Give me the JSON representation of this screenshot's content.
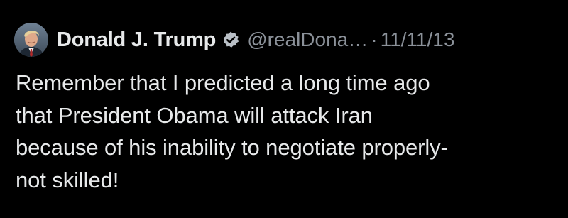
{
  "tweet": {
    "author": {
      "display_name": "Donald J. Trump",
      "handle": "@realDona…",
      "verified": true,
      "avatar_icon": "portrait-avatar"
    },
    "separator": "·",
    "date": "11/11/13",
    "text": "Remember that I predicted a long time ago\nthat President Obama will attack Iran\nbecause of his inability to negotiate properly-\nnot skilled!"
  },
  "colors": {
    "background": "#000000",
    "primary_text": "#e7e9ea",
    "secondary_text": "#8b9199",
    "verified_badge": "#b9bfc6"
  }
}
